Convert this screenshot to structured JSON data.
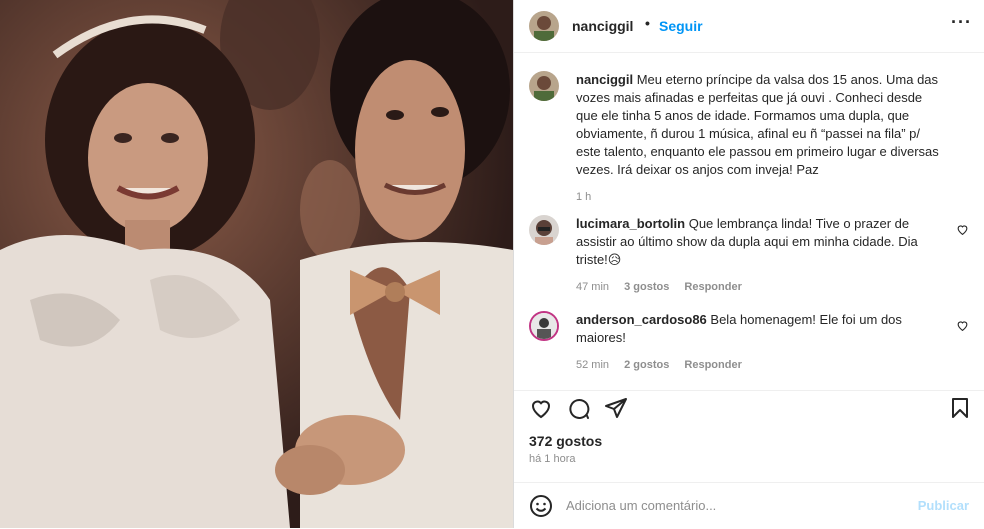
{
  "post": {
    "username": "nanciggil",
    "separator": "•",
    "follow_label": "Seguir",
    "more_label": "···",
    "caption": {
      "username": "nanciggil",
      "text": "Meu eterno príncipe da valsa dos 15 anos. Uma das vozes mais afinadas e perfeitas que já ouvi . Conheci desde que ele tinha 5 anos de idade. Formamos uma dupla, que obviamente, ñ durou 1 música, afinal eu ñ “passei na fila” p/ este talento, enquanto ele passou em primeiro lugar e diversas vezes. Irá deixar os anjos com inveja! Paz",
      "time": "1 h"
    },
    "comments": [
      {
        "username": "lucimara_bortolin",
        "text": "Que lembrança linda! Tive o prazer de assistir ao último show da dupla aqui em minha cidade. Dia triste!😥",
        "time": "47 min",
        "likes": "3 gostos",
        "reply": "Responder"
      },
      {
        "username": "anderson_cardoso86",
        "text": "Bela homenagem! Ele foi um dos maiores!",
        "time": "52 min",
        "likes": "2 gostos",
        "reply": "Responder"
      }
    ],
    "likes_count": "372 gostos",
    "posted_ago": "há 1 hora",
    "comment_placeholder": "Adiciona um comentário...",
    "publish_label": "Publicar",
    "colors": {
      "link": "#0095f6",
      "publish_disabled": "#b2dffc",
      "muted": "#8e8e8e"
    },
    "icons": [
      "heart-icon",
      "comment-icon",
      "share-icon",
      "bookmark-icon",
      "emoji-icon",
      "more-icon"
    ]
  }
}
